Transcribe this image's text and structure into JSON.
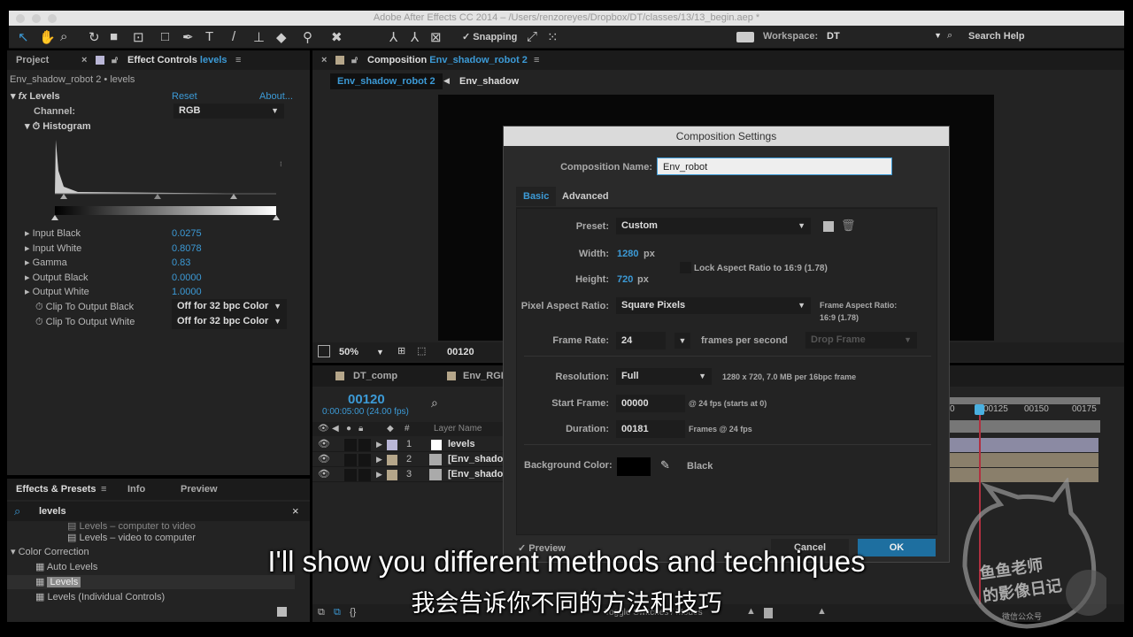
{
  "window": {
    "title": "Adobe After Effects CC 2014 – /Users/renzoreyes/Dropbox/DT/classes/13/13_begin.aep *"
  },
  "toolbar": {
    "snapping": "Snapping",
    "workspace_label": "Workspace:",
    "workspace_value": "DT",
    "search_help": "Search Help"
  },
  "left_panel": {
    "tab_project": "Project",
    "tab_effect_controls": "Effect Controls",
    "effect_layer": "levels",
    "breadcrumb": "Env_shadow_robot 2 • levels",
    "effect": {
      "name": "Levels",
      "reset": "Reset",
      "about": "About...",
      "channel_label": "Channel:",
      "channel_value": "RGB",
      "histogram_label": "Histogram",
      "params": [
        {
          "label": "Input Black",
          "value": "0.0275"
        },
        {
          "label": "Input White",
          "value": "0.8078"
        },
        {
          "label": "Gamma",
          "value": "0.83"
        },
        {
          "label": "Output Black",
          "value": "0.0000"
        },
        {
          "label": "Output White",
          "value": "1.0000"
        }
      ],
      "clip_black_label": "Clip To Output Black",
      "clip_black_value": "Off for 32 bpc Color",
      "clip_white_label": "Clip To Output White",
      "clip_white_value": "Off for 32 bpc Color"
    }
  },
  "effects_presets": {
    "tab_effects": "Effects & Presets",
    "tab_info": "Info",
    "tab_preview": "Preview",
    "search_value": "levels",
    "items": [
      "Levels – computer to video",
      "Levels – video to computer"
    ],
    "category": "Color Correction",
    "category_items": [
      "Auto Levels",
      "Levels",
      "Levels (Individual Controls)"
    ],
    "selected": "Levels"
  },
  "composition": {
    "tab_label": "Composition",
    "comp_name": "Env_shadow_robot 2",
    "crumbs": [
      "Env_shadow_robot 2",
      "Env_shadow"
    ],
    "zoom": "50%",
    "timecode": "00120"
  },
  "timeline": {
    "tabs": [
      "DT_comp",
      "Env_RGB"
    ],
    "current_frame": "00120",
    "current_time": "0:00:05:00 (24.00 fps)",
    "col_num": "#",
    "col_layer": "Layer Name",
    "layers": [
      {
        "num": "1",
        "name": "levels",
        "color": "#b9b6d6"
      },
      {
        "num": "2",
        "name": "[Env_shado",
        "color": "#b5a68a"
      },
      {
        "num": "3",
        "name": "[Env_shado",
        "color": "#b5a68a"
      }
    ],
    "ruler": [
      "0",
      "00125",
      "00150",
      "00175"
    ],
    "footer": "Toggle Switches / Modes"
  },
  "dialog": {
    "title": "Composition Settings",
    "name_label": "Composition Name:",
    "name_value": "Env_robot",
    "tabs": [
      "Basic",
      "Advanced"
    ],
    "preset_label": "Preset:",
    "preset_value": "Custom",
    "width_label": "Width:",
    "width_value": "1280",
    "height_label": "Height:",
    "height_value": "720",
    "px": "px",
    "lock_label": "Lock Aspect Ratio to 16:9 (1.78)",
    "par_label": "Pixel Aspect Ratio:",
    "par_value": "Square Pixels",
    "far_label": "Frame Aspect Ratio:",
    "far_value": "16:9 (1.78)",
    "fr_label": "Frame Rate:",
    "fr_value": "24",
    "fr_unit": "frames per second",
    "drop_frame": "Drop Frame",
    "res_label": "Resolution:",
    "res_value": "Full",
    "res_note": "1280 x 720, 7.0 MB per 16bpc frame",
    "start_label": "Start Frame:",
    "start_value": "00000",
    "start_note": "@ 24 fps (starts at 0)",
    "dur_label": "Duration:",
    "dur_value": "00181",
    "dur_note": "Frames @ 24 fps",
    "bg_label": "Background Color:",
    "bg_color": "#000000",
    "bg_name": "Black",
    "preview": "Preview",
    "cancel": "Cancel",
    "ok": "OK"
  },
  "subtitles": {
    "en": "I'll show you different methods and techniques",
    "zh": "我会告诉你不同的方法和技巧"
  },
  "watermark": {
    "text1": "鱼鱼老师",
    "text2": "的影像日记",
    "text3": "微信公众号"
  }
}
